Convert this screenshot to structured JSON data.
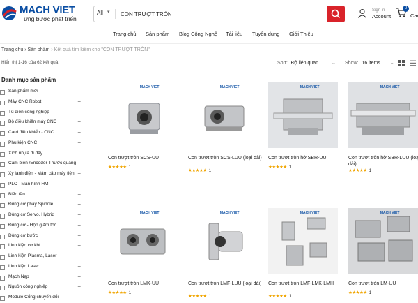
{
  "header": {
    "logo_name": "MACH VIET",
    "logo_tagline": "Từng bước phát triển",
    "search": {
      "category": "All",
      "query": "CON TRƯỢT TRÒN"
    },
    "account_small": "Sign in",
    "account_label": "Account",
    "cart_count": "0",
    "cart_label": "Cart"
  },
  "nav": [
    "Trang chủ",
    "Sản phẩm",
    "Blog Công Nghệ",
    "Tài liệu",
    "Tuyển dụng",
    "Giới Thiệu"
  ],
  "breadcrumb": {
    "home": "Trang chủ",
    "sep": "›",
    "products": "Sản phẩm",
    "current": "Kết quả tìm kiếm cho \"CON TRƯỢT TRÒN\""
  },
  "toolbar": {
    "result_count": "Hiển thị 1-16 của 62 kết quả",
    "sort_label": "Sort:",
    "sort_value": "Độ liên quan",
    "show_label": "Show:",
    "show_value": "16 items"
  },
  "sidebar": {
    "title": "Danh mục sản phẩm",
    "items": [
      {
        "label": "Sản phẩm mới",
        "expand": ""
      },
      {
        "label": "Máy CNC Robot",
        "expand": "+"
      },
      {
        "label": "Tủ điện công nghiệp",
        "expand": "+"
      },
      {
        "label": "Bộ điều khiển máy CNC",
        "expand": "+"
      },
      {
        "label": "Card điều khiển - CNC",
        "expand": "+"
      },
      {
        "label": "Phụ kiện CNC",
        "expand": "+"
      },
      {
        "label": "Xích nhựa đi dây",
        "expand": ""
      },
      {
        "label": "Cảm biến /Encoder-Thước quang",
        "expand": "+"
      },
      {
        "label": "Xy lanh điện - Mâm cặp máy tiện",
        "expand": "+"
      },
      {
        "label": "PLC - Màn hình HMI",
        "expand": "+"
      },
      {
        "label": "Biến tần",
        "expand": "+"
      },
      {
        "label": "Động cơ phay Spindle",
        "expand": "+"
      },
      {
        "label": "Động cơ Servo, Hybrid",
        "expand": "+"
      },
      {
        "label": "Động cơ - Hộp giảm tốc",
        "expand": "+"
      },
      {
        "label": "Động cơ bước",
        "expand": "+"
      },
      {
        "label": "Linh kiện cơ khí",
        "expand": "+"
      },
      {
        "label": "Linh kiện Plasma, Laser",
        "expand": "+"
      },
      {
        "label": "Linh kiện Laser",
        "expand": "+"
      },
      {
        "label": "Mạch Nạp",
        "expand": "+"
      },
      {
        "label": "Nguồn công nghiệp",
        "expand": "+"
      },
      {
        "label": "Module Cổng chuyển đổi",
        "expand": "+"
      }
    ]
  },
  "products": [
    {
      "title": "Con trượt tròn SCS-UU",
      "stars": "★★★★★",
      "reviews": "1"
    },
    {
      "title": "Con trượt tròn SCS-LUU (loại dài)",
      "stars": "★★★★★",
      "reviews": "1"
    },
    {
      "title": "Con trượt tròn hở SBR-UU",
      "stars": "★★★★★",
      "reviews": "1"
    },
    {
      "title": "Con trượt tròn hở SBR-LUU (loại dài)",
      "stars": "★★★★★",
      "reviews": "1"
    },
    {
      "title": "Con trượt tròn LMK-UU",
      "stars": "★★★★★",
      "reviews": "1"
    },
    {
      "title": "Con trượt tròn LMF-LUU (loại dài)",
      "stars": "★★★★★",
      "reviews": "1"
    },
    {
      "title": "Con trượt tròn LMF-LMK-LMH",
      "stars": "★★★★★",
      "reviews": "1"
    },
    {
      "title": "Con trượt tròn LM-UU",
      "stars": "★★★★★",
      "reviews": "1"
    }
  ],
  "image_brand": "MACH VIET",
  "colors": {
    "brand_blue": "#0a4ea3",
    "search_red": "#d9232a",
    "star": "#f0a500"
  }
}
